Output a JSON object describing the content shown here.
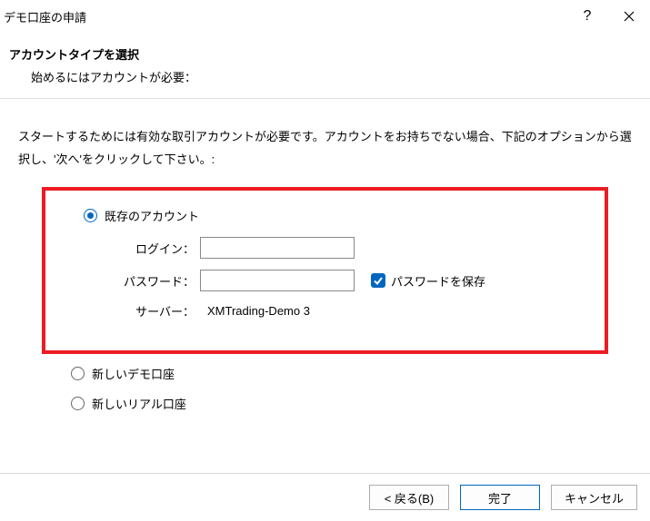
{
  "window": {
    "title": "デモ口座の申請"
  },
  "header": {
    "title": "アカウントタイプを選択",
    "subtitle": "始めるにはアカウントが必要："
  },
  "intro": "スタートするためには有効な取引アカウントが必要です。アカウントをお持ちでない場合、下記のオプションから選択し、'次へ'をクリックして下さい。:",
  "options": {
    "existing": {
      "label": "既存のアカウント",
      "selected": true,
      "fields": {
        "login_label": "ログイン：",
        "login_value": "",
        "password_label": "パスワード：",
        "password_value": "",
        "save_password_label": "パスワードを保存",
        "save_password_checked": true,
        "server_label": "サーバー：",
        "server_value": "XMTrading-Demo 3"
      }
    },
    "new_demo": {
      "label": "新しいデモ口座",
      "selected": false
    },
    "new_real": {
      "label": "新しいリアル口座",
      "selected": false
    }
  },
  "buttons": {
    "back": "< 戻る(B)",
    "finish": "完了",
    "cancel": "キャンセル"
  }
}
